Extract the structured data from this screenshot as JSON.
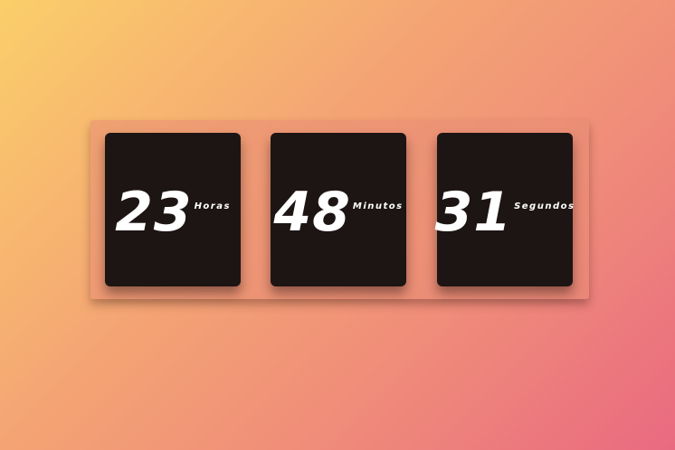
{
  "countdown": {
    "hours": {
      "value": "23",
      "label": "Horas"
    },
    "minutes": {
      "value": "48",
      "label": "Minutos"
    },
    "seconds": {
      "value": "31",
      "label": "Segundos"
    }
  },
  "colors": {
    "card_background": "#1d1513",
    "text": "#ffffff",
    "gradient_start": "#fbcf6a",
    "gradient_end": "#e96a80"
  }
}
